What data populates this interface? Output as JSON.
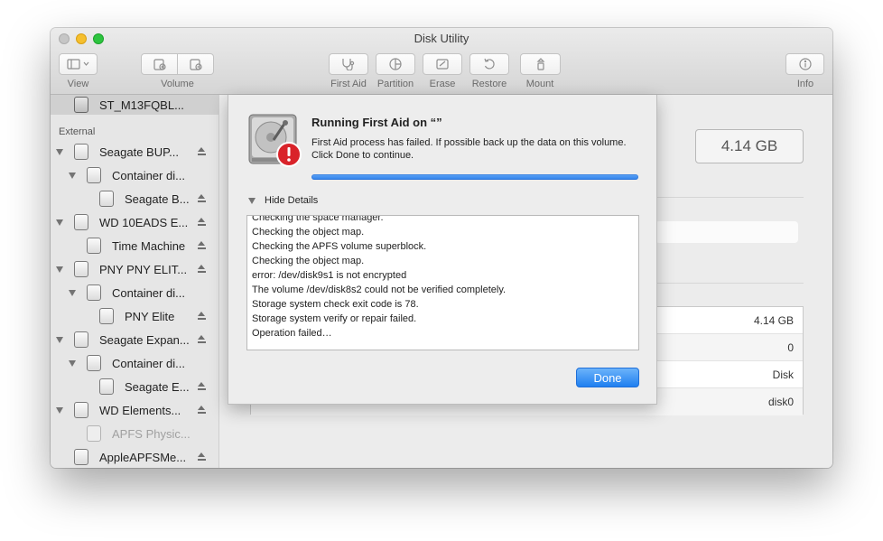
{
  "window": {
    "title": "Disk Utility"
  },
  "toolbar": {
    "view_label": "View",
    "volume_label": "Volume",
    "first_aid_label": "First Aid",
    "partition_label": "Partition",
    "erase_label": "Erase",
    "restore_label": "Restore",
    "mount_label": "Mount",
    "info_label": "Info"
  },
  "sidebar": {
    "selected": "ST_M13FQBL...",
    "section_external": "External",
    "items": [
      {
        "label": "Seagate BUP...",
        "indent": 0,
        "expanded": true,
        "eject": true,
        "dim": false
      },
      {
        "label": "Container di...",
        "indent": 1,
        "expanded": true,
        "eject": false,
        "dim": false
      },
      {
        "label": "Seagate B...",
        "indent": 2,
        "expanded": false,
        "eject": true,
        "dim": false
      },
      {
        "label": "WD 10EADS E...",
        "indent": 0,
        "expanded": true,
        "eject": true,
        "dim": false
      },
      {
        "label": "Time Machine",
        "indent": 1,
        "expanded": false,
        "eject": true,
        "dim": false
      },
      {
        "label": "PNY PNY ELIT...",
        "indent": 0,
        "expanded": true,
        "eject": true,
        "dim": false
      },
      {
        "label": "Container di...",
        "indent": 1,
        "expanded": true,
        "eject": false,
        "dim": false
      },
      {
        "label": "PNY Elite",
        "indent": 2,
        "expanded": false,
        "eject": true,
        "dim": false
      },
      {
        "label": "Seagate Expan...",
        "indent": 0,
        "expanded": true,
        "eject": true,
        "dim": false
      },
      {
        "label": "Container di...",
        "indent": 1,
        "expanded": true,
        "eject": false,
        "dim": false
      },
      {
        "label": "Seagate E...",
        "indent": 2,
        "expanded": false,
        "eject": true,
        "dim": false
      },
      {
        "label": "WD Elements...",
        "indent": 0,
        "expanded": true,
        "eject": true,
        "dim": false
      },
      {
        "label": "APFS Physic...",
        "indent": 1,
        "expanded": false,
        "eject": false,
        "dim": true
      },
      {
        "label": "AppleAPFSMe...",
        "indent": 0,
        "expanded": false,
        "eject": true,
        "dim": false
      }
    ]
  },
  "content": {
    "capacity": "4.14 GB",
    "info_values": [
      "4.14 GB",
      "0",
      "Disk",
      "disk0"
    ]
  },
  "sheet": {
    "title": "Running First Aid on “”",
    "message": "First Aid process has failed. If possible back up the data on this volume. Click Done to continue.",
    "progress": 1.0,
    "details_toggle": "Hide Details",
    "log": [
      "Checking the space manager.",
      "Checking the object map.",
      "Checking the APFS volume superblock.",
      "Checking the object map.",
      "error: /dev/disk9s1 is not encrypted",
      "The volume /dev/disk8s2 could not be verified completely.",
      "Storage system check exit code is 78.",
      "Storage system verify or repair failed.",
      "Operation failed…"
    ],
    "done_label": "Done"
  },
  "colors": {
    "accent": "#2f80ea",
    "alert": "#d9232a"
  }
}
